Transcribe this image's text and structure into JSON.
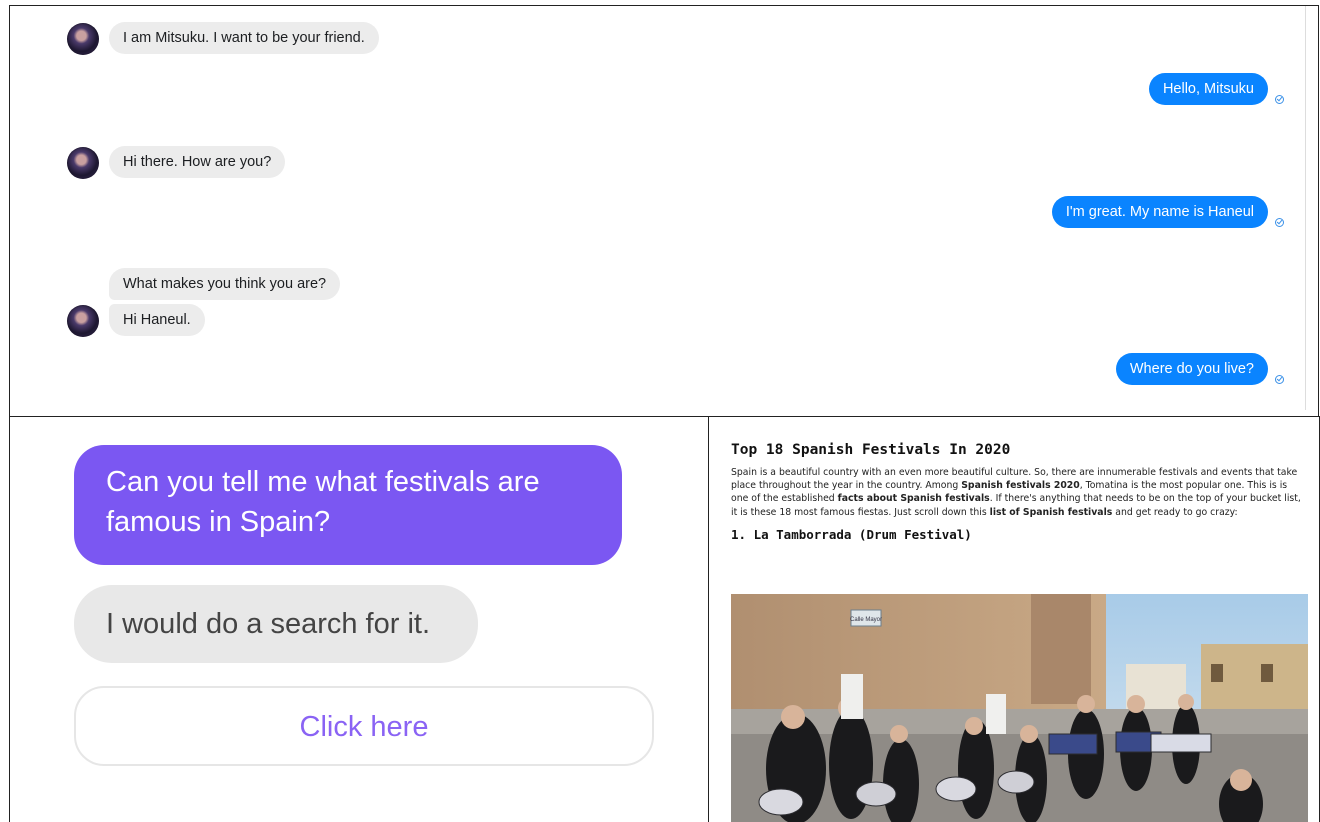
{
  "chat": {
    "messages": [
      {
        "from": "bot",
        "text": "I am Mitsuku. I want to be your friend."
      },
      {
        "from": "user",
        "text": "Hello, Mitsuku"
      },
      {
        "from": "bot",
        "text": "Hi there. How are you?"
      },
      {
        "from": "user",
        "text": "I'm great. My name is Haneul"
      },
      {
        "from": "bot",
        "text": "What makes you think you are?"
      },
      {
        "from": "bot",
        "text": "Hi Haneul."
      },
      {
        "from": "user",
        "text": "Where do you live?"
      }
    ]
  },
  "assistant": {
    "question": "Can you tell me what festivals are famous in Spain?",
    "answer": "I would do a search for it.",
    "button_label": "Click here"
  },
  "article": {
    "title": "Top 18 Spanish Festivals In 2020",
    "para": [
      {
        "t": "Spain is a beautiful country with an even more beautiful culture. So, there are innumerable festivals and events that take place throughout the year in the country. Among ",
        "b": false
      },
      {
        "t": "Spanish festivals 2020",
        "b": true
      },
      {
        "t": ", Tomatina is the most popular one. This is is one of the established ",
        "b": false
      },
      {
        "t": "facts about Spanish festivals",
        "b": true
      },
      {
        "t": ". If there's anything that needs to be on the top of your bucket list, it is these 18 most famous fiestas. Just scroll down this ",
        "b": false
      },
      {
        "t": "list of Spanish festivals",
        "b": true
      },
      {
        "t": " and get ready to go crazy:",
        "b": false
      }
    ],
    "subheading": "1. La Tamborrada (Drum Festival)",
    "photo_sign": "Calle Mayor"
  },
  "colors": {
    "user_bubble": "#0a84ff",
    "bot_bubble": "#ececec",
    "assistant_question": "#7b57f2",
    "link_text": "#8a63f4"
  }
}
